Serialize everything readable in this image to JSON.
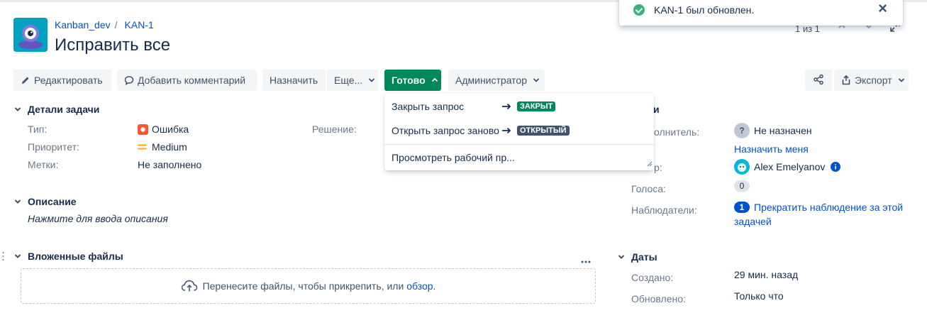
{
  "breadcrumbs": {
    "project": "Kanban_dev",
    "issue_key": "KAN-1"
  },
  "issue": {
    "title": "Исправить все"
  },
  "pager": {
    "text": "1 из 1"
  },
  "toast": {
    "message": "KAN-1 был обновлен."
  },
  "toolbar": {
    "edit_label": "Редактировать",
    "comment_label": "Добавить комментарий",
    "assign_label": "Назначить",
    "more_label": "Еще...",
    "status_label": "Готово",
    "admin_label": "Администратор",
    "export_label": "Экспорт"
  },
  "details": {
    "heading": "Детали задачи",
    "type_label": "Тип:",
    "type_value": "Ошибка",
    "priority_label": "Приоритет:",
    "priority_value": "Medium",
    "labels_label": "Метки:",
    "labels_value": "Не заполнено",
    "resolution_label": "Решение:"
  },
  "description": {
    "heading": "Описание",
    "placeholder": "Нажмите для ввода описания"
  },
  "attachments": {
    "heading": "Вложенные файлы",
    "drop_text": "Перенесите файлы, чтобы прикрепить, или",
    "browse_link": "обзор."
  },
  "transitions": {
    "items": [
      {
        "label": "Закрыть запрос",
        "target": "ЗАКРЫТ",
        "color": "#00875a"
      },
      {
        "label": "Открыть запрос заново",
        "target": "ОТКРЫТЫЙ",
        "color": "#42526e"
      }
    ],
    "workflow_label": "Просмотреть рабочий пр..."
  },
  "people": {
    "heading_partial": "и",
    "assignee_label_partial": "олнитель:",
    "assignee_value": "Не назначен",
    "assign_me": "Назначить меня",
    "reporter_label_partial": "р:",
    "reporter_value": "Alex Emelyanov",
    "votes_label": "Голоса:",
    "votes_value": "0",
    "watchers_label": "Наблюдатели:",
    "watchers_count": "1",
    "watchers_action": "Прекратить наблюдение за этой",
    "watchers_action_2": "задачей"
  },
  "dates": {
    "heading": "Даты",
    "created_label": "Создано:",
    "created_value": "29 мин. назад",
    "updated_label": "Обновлено:",
    "updated_value": "Только что"
  },
  "colors": {
    "link": "#0052cc",
    "primary": "#00875a",
    "bug": "#ff5630",
    "priority_medium": "#ffab00"
  }
}
